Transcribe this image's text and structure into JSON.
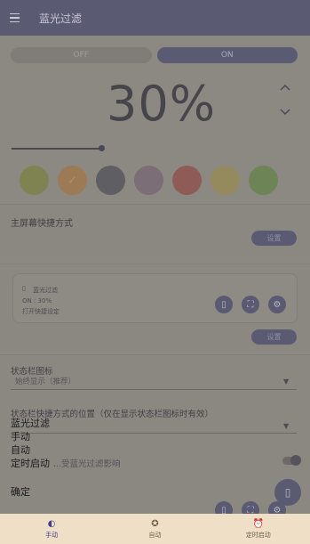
{
  "app": {
    "title": "蓝光过滤"
  },
  "toggle": {
    "off_label": "OFF",
    "on_label": "ON",
    "selected": "ON"
  },
  "intensity": {
    "value_text": "30%",
    "level": 0.3
  },
  "swatches": [
    {
      "name": "yellow-green",
      "color": "#7f8352",
      "selected": false
    },
    {
      "name": "orange",
      "color": "#9b7a55",
      "selected": true
    },
    {
      "name": "gray",
      "color": "#5f5e62",
      "selected": false
    },
    {
      "name": "mauve",
      "color": "#7b6e77",
      "selected": false
    },
    {
      "name": "red",
      "color": "#8e5b57",
      "selected": false
    },
    {
      "name": "yellow",
      "color": "#958a5e",
      "selected": false
    },
    {
      "name": "green",
      "color": "#6c8456",
      "selected": false
    }
  ],
  "main_shortcut": {
    "title": "主屏幕快捷方式",
    "button": "设置"
  },
  "widget": {
    "name": "蓝光过滤",
    "status": "ON : 30%",
    "hint": "打开快捷设定",
    "button": "设置"
  },
  "statusbar_icon": {
    "label": "状态栏图标",
    "value": "始终显示（推荐）"
  },
  "statusbar_shortcut": {
    "label": "状态栏快捷方式的位置（仅在显示状态栏图标时有效）"
  },
  "overlay_menu": {
    "items": [
      "蓝光过滤",
      "手动",
      "自动",
      "定时启动"
    ],
    "confirm": "确定"
  },
  "hidden_row": {
    "label": "...受蓝光过滤影响"
  },
  "bottom_nav": {
    "items": [
      {
        "label": "手动",
        "icon": "manual-icon",
        "active": true
      },
      {
        "label": "自动",
        "icon": "auto-icon",
        "active": false
      },
      {
        "label": "定时启动",
        "icon": "alarm-icon",
        "active": false
      }
    ]
  },
  "colors": {
    "accent": "#5a5a73",
    "overlay": "#8c8882",
    "bottom_nav_bg": "#efdfc7",
    "active_nav": "#3f3c8f"
  }
}
